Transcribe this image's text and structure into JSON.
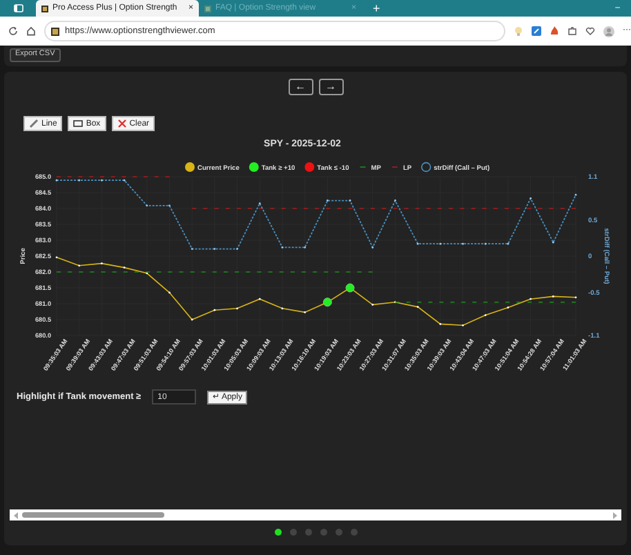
{
  "browser": {
    "tabs": [
      {
        "title": "Pro Access Plus | Option Strength",
        "close": "×",
        "selected": true
      },
      {
        "title": "FAQ | Option Strength view",
        "close": "×",
        "selected": false
      }
    ],
    "new_tab": "+",
    "minimize": "–",
    "url": "https://www.optionstrengthviewer.com",
    "menu": "···"
  },
  "page": {
    "export_button": "Export CSV",
    "nav_buttons": [
      "←",
      "→"
    ],
    "tools": [
      {
        "kind": "line",
        "label": "Line"
      },
      {
        "kind": "box",
        "label": "Box"
      },
      {
        "kind": "clear",
        "label": "Clear"
      }
    ],
    "chart_data": {
      "type": "line",
      "title": "SPY - 2025-12-02",
      "grid": true,
      "legend": true,
      "ylabel": "Price",
      "y2label": "strDiff (Call – Put)",
      "categories": [
        "09:35:03 AM",
        "09:39:03 AM",
        "09:43:03 AM",
        "09:47:03 AM",
        "09:51:03 AM",
        "09:54:10 AM",
        "09:57:03 AM",
        "10:01:03 AM",
        "10:05:03 AM",
        "10:09:03 AM",
        "10:13:03 AM",
        "10:16:10 AM",
        "10:19:03 AM",
        "10:23:03 AM",
        "10:27:03 AM",
        "10:31:07 AM",
        "10:35:03 AM",
        "10:39:03 AM",
        "10:43:04 AM",
        "10:47:03 AM",
        "10:51:04 AM",
        "10:54:28 AM",
        "10:57:04 AM",
        "11:01:03 AM"
      ],
      "ylim": [
        680,
        685
      ],
      "yticks": [
        {
          "value": 680,
          "label": "680.0"
        },
        {
          "value": 680.5,
          "label": "680.5"
        },
        {
          "value": 681,
          "label": "681.0"
        },
        {
          "value": 681.5,
          "label": "681.5"
        },
        {
          "value": 682,
          "label": "682.0"
        },
        {
          "value": 682.5,
          "label": "682.5"
        },
        {
          "value": 683,
          "label": "683.0"
        },
        {
          "value": 683.5,
          "label": "683.5"
        },
        {
          "value": 684,
          "label": "684.0"
        },
        {
          "value": 684.5,
          "label": "684.5"
        },
        {
          "value": 685,
          "label": "685.0"
        }
      ],
      "y2lim": [
        -1.1,
        1.1
      ],
      "y2ticks": [
        {
          "value": 1.1,
          "label": "1.1"
        },
        {
          "value": 0.5,
          "label": "0.5"
        },
        {
          "value": 0,
          "label": "0"
        },
        {
          "value": -0.5,
          "label": "-0.5"
        },
        {
          "value": -1.1,
          "label": "-1.1"
        }
      ],
      "series": [
        {
          "name": "Current Price",
          "line_style": "solid",
          "color": "#d8b416",
          "values": [
            682.46,
            682.2,
            682.27,
            682.14,
            681.96,
            681.35,
            680.5,
            680.8,
            680.85,
            681.15,
            680.85,
            680.73,
            681.05,
            681.5,
            680.97,
            681.05,
            680.9,
            680.36,
            680.32,
            680.64,
            680.88,
            681.15,
            681.23,
            681.2
          ]
        },
        {
          "name": "Tank ≥ +10",
          "type": "scatter",
          "color": "#22ee22",
          "values": [
            null,
            null,
            null,
            null,
            null,
            null,
            null,
            null,
            null,
            null,
            null,
            null,
            681.05,
            681.5,
            null,
            null,
            null,
            null,
            null,
            null,
            null,
            null,
            null,
            null
          ]
        },
        {
          "name": "Tank ≤ -10",
          "type": "scatter",
          "color": "#ee1111",
          "values": [
            null,
            null,
            null,
            null,
            null,
            null,
            null,
            null,
            null,
            null,
            null,
            null,
            null,
            null,
            null,
            null,
            null,
            null,
            null,
            null,
            null,
            null,
            null,
            null
          ]
        },
        {
          "name": "MP",
          "line_style": "dashed",
          "color": "#1f8a1f",
          "values": [
            682,
            682,
            682,
            682,
            682,
            682,
            682,
            682,
            682,
            682,
            682,
            682,
            682,
            682,
            682,
            681.05,
            681.05,
            681.05,
            681.05,
            681.05,
            681.05,
            681.05,
            681.05,
            681.05
          ]
        },
        {
          "name": "LP",
          "line_style": "dashed",
          "color": "#a51d1d",
          "values": [
            685,
            685,
            685,
            685,
            685,
            685,
            684,
            684,
            684,
            684,
            684,
            684,
            684,
            684,
            684,
            684,
            684,
            684,
            684,
            684,
            684,
            684,
            684,
            684
          ]
        },
        {
          "name": "strDiff (Call – Put)",
          "axis": "y2",
          "line_style": "dotted",
          "color": "#4a8fc0",
          "values": [
            1.05,
            1.05,
            1.05,
            1.05,
            0.7,
            0.7,
            0.1,
            0.1,
            0.1,
            0.73,
            0.12,
            0.12,
            0.77,
            0.77,
            0.12,
            0.77,
            0.17,
            0.17,
            0.17,
            0.17,
            0.17,
            0.8,
            0.19,
            0.85
          ]
        }
      ]
    },
    "highlight": {
      "label": "Highlight if Tank movement ≥",
      "value": "10",
      "button": "↵ Apply"
    },
    "pages": [
      {
        "selected": true
      },
      {
        "selected": false
      },
      {
        "selected": false
      },
      {
        "selected": false
      },
      {
        "selected": false
      },
      {
        "selected": false
      }
    ]
  }
}
